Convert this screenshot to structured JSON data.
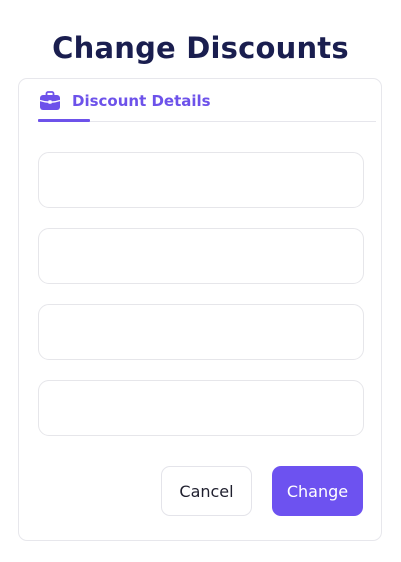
{
  "page": {
    "title": "Change Discounts"
  },
  "tabs": [
    {
      "label": "Discount Details",
      "icon": "briefcase-icon",
      "active": true
    }
  ],
  "form": {
    "fields": [
      {
        "value": "",
        "placeholder": ""
      },
      {
        "value": "",
        "placeholder": ""
      },
      {
        "value": "",
        "placeholder": ""
      },
      {
        "value": "",
        "placeholder": ""
      }
    ]
  },
  "actions": {
    "cancel_label": "Cancel",
    "submit_label": "Change"
  },
  "colors": {
    "accent": "#6d52f0",
    "title": "#1a1e4f",
    "border": "#e6e6ea"
  }
}
